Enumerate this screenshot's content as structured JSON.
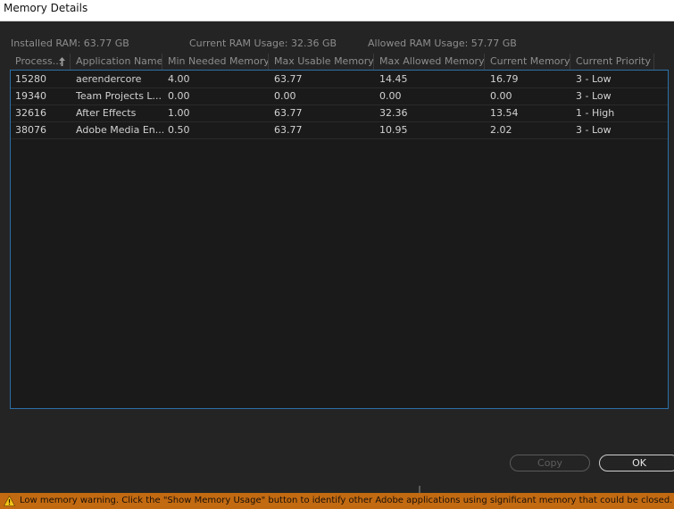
{
  "window": {
    "title": "Memory Details"
  },
  "summary": {
    "installed": "Installed RAM: 63.77 GB",
    "current": "Current RAM Usage: 32.36 GB",
    "allowed": "Allowed RAM Usage: 57.77 GB"
  },
  "table": {
    "columns": [
      "Process...",
      "Application Name",
      "Min Needed Memory",
      "Max Usable Memory",
      "Max Allowed Memory",
      "Current Memory",
      "Current Priority"
    ],
    "sort": {
      "column": "Process...",
      "direction": "ascending",
      "icon": "sort-up-arrow-icon"
    },
    "rows": [
      [
        "15280",
        "aerendercore",
        "4.00",
        "63.77",
        "14.45",
        "16.79",
        "3 - Low"
      ],
      [
        "19340",
        "Team Projects L...",
        "0.00",
        "0.00",
        "0.00",
        "0.00",
        "3 - Low"
      ],
      [
        "32616",
        "After Effects",
        "1.00",
        "63.77",
        "32.36",
        "13.54",
        "1 - High"
      ],
      [
        "38076",
        "Adobe Media En...",
        "0.50",
        "63.77",
        "10.95",
        "2.02",
        "3 - Low"
      ]
    ]
  },
  "buttons": {
    "copy": "Copy",
    "ok": "OK"
  },
  "warning": {
    "icon": "warning-triangle-icon",
    "text": "Low memory warning. Click the \"Show Memory Usage\" button to identify other Adobe applications using significant memory that could be closed.",
    "color": "#c26a12"
  },
  "colors": {
    "background": "#242424",
    "accent": "#2d6fa8"
  }
}
